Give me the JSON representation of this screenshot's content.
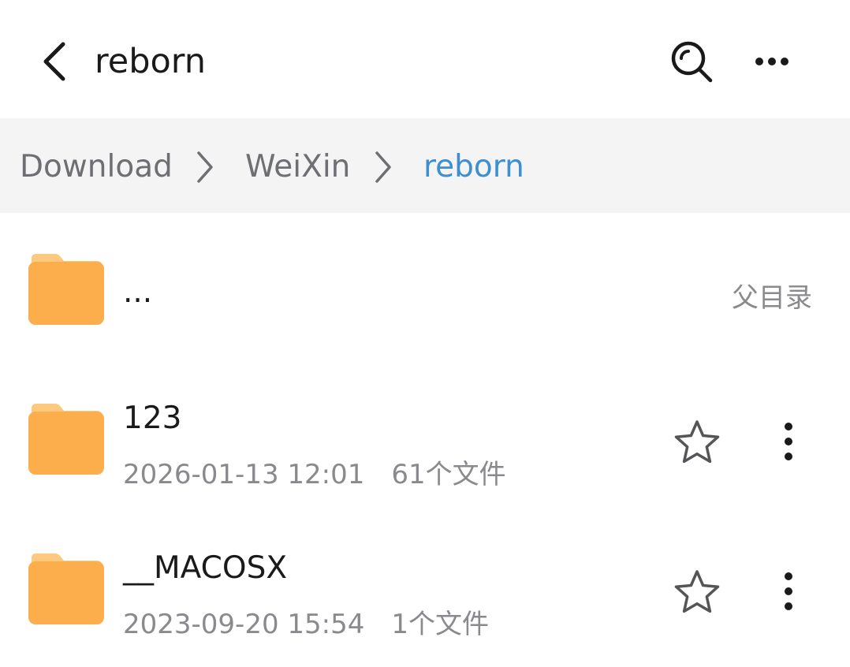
{
  "header": {
    "title": "reborn",
    "back_icon": "chevron-left-icon",
    "search_icon": "search-icon",
    "more_icon": "more-horizontal-icon"
  },
  "breadcrumb": {
    "items": [
      {
        "label": "Download"
      },
      {
        "label": "WeiXin"
      },
      {
        "label": "reborn"
      }
    ],
    "active_color": "#3e8fd0"
  },
  "files": {
    "parent": {
      "name": "...",
      "label": "父目录"
    },
    "items": [
      {
        "name": "123",
        "date": "2026-01-13 12:01",
        "count": "61个文件"
      },
      {
        "name": "__MACOSX",
        "date": "2023-09-20 15:54",
        "count": "1个文件"
      }
    ]
  },
  "colors": {
    "folder": "#fbae4b",
    "folder_tab": "#fcc97f"
  }
}
